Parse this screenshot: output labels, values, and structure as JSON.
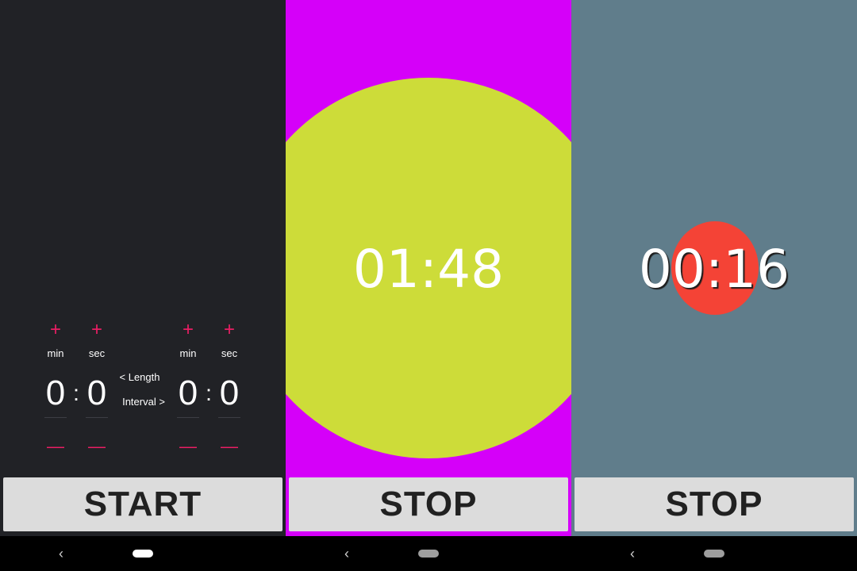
{
  "setup_screen": {
    "length": {
      "min_label": "min",
      "sec_label": "sec",
      "min_value": "0",
      "sec_value": "0",
      "separator": ":",
      "plus": "+",
      "minus": "—"
    },
    "interval": {
      "min_label": "min",
      "sec_label": "sec",
      "min_value": "0",
      "sec_value": "0",
      "separator": ":",
      "plus": "+",
      "minus": "—"
    },
    "length_label": "< Length",
    "interval_label": "Interval >",
    "start_button": "START",
    "background_color": "#212226",
    "accent_color": "#e91e63"
  },
  "running_screen_1": {
    "time": "01:48",
    "stop_button": "STOP",
    "background_color": "#d500f9",
    "circle_color": "#cddc39"
  },
  "running_screen_2": {
    "time": "00:16",
    "stop_button": "STOP",
    "background_color": "#607d8b",
    "circle_color": "#f44336"
  },
  "navbar": {
    "back_glyph": "‹",
    "icons": [
      "back-icon",
      "home-pill-icon"
    ]
  }
}
